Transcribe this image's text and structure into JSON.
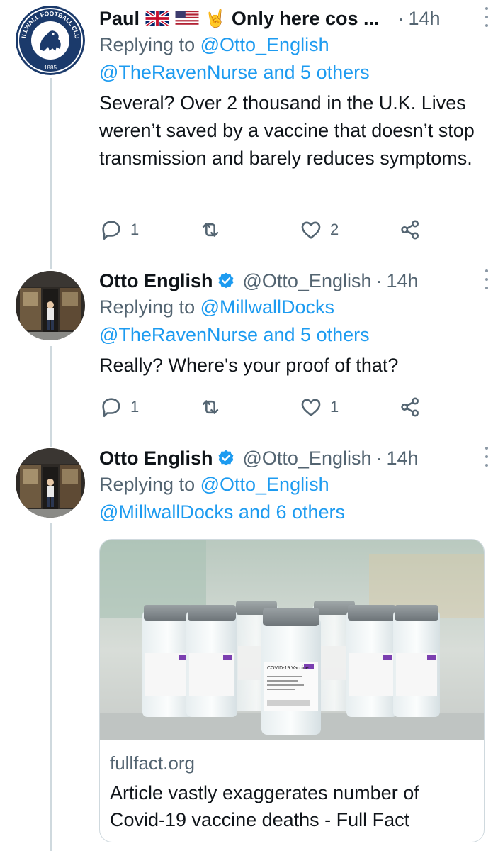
{
  "tweets": [
    {
      "name": "Paul",
      "name_suffix": "Only here cos ...",
      "emoji_hand": "🤘",
      "handle": "",
      "time": "14h",
      "replying_prefix": "Replying to ",
      "replying_to": "@Otto_English",
      "mentions": "@TheRavenNurse and 5 others",
      "text": "Several? Over 2 thousand in the U.K. Lives weren’t saved by a vaccine that doesn’t stop transmission and barely reduces symptoms.",
      "replies": "1",
      "retweets": "",
      "likes": "2",
      "avatar_text_top": "MILLWALL FOOTBALL CLUB",
      "avatar_text_year": "1885"
    },
    {
      "name": "Otto English",
      "handle": "@Otto_English",
      "time": "14h",
      "replying_prefix": "Replying to ",
      "replying_to": "@MillwallDocks",
      "mentions": "@TheRavenNurse and 5 others",
      "text": "Really? Where's your proof of that?",
      "replies": "1",
      "retweets": "",
      "likes": "1"
    },
    {
      "name": "Otto English",
      "handle": "@Otto_English",
      "time": "14h",
      "replying_prefix": "Replying to ",
      "replying_to": "@Otto_English",
      "mentions": "@MillwallDocks and 6 others",
      "card": {
        "domain": "fullfact.org",
        "title": "Article vastly exaggerates number of Covid-19 vaccine deaths - Full Fact",
        "vial_label": "COVID-19 Vaccine"
      }
    }
  ],
  "separator": "·",
  "colors": {
    "link": "#1d9bf0",
    "secondary": "#536471",
    "thread_line": "#cfd9de",
    "millwall_navy": "#1b3a6b"
  }
}
